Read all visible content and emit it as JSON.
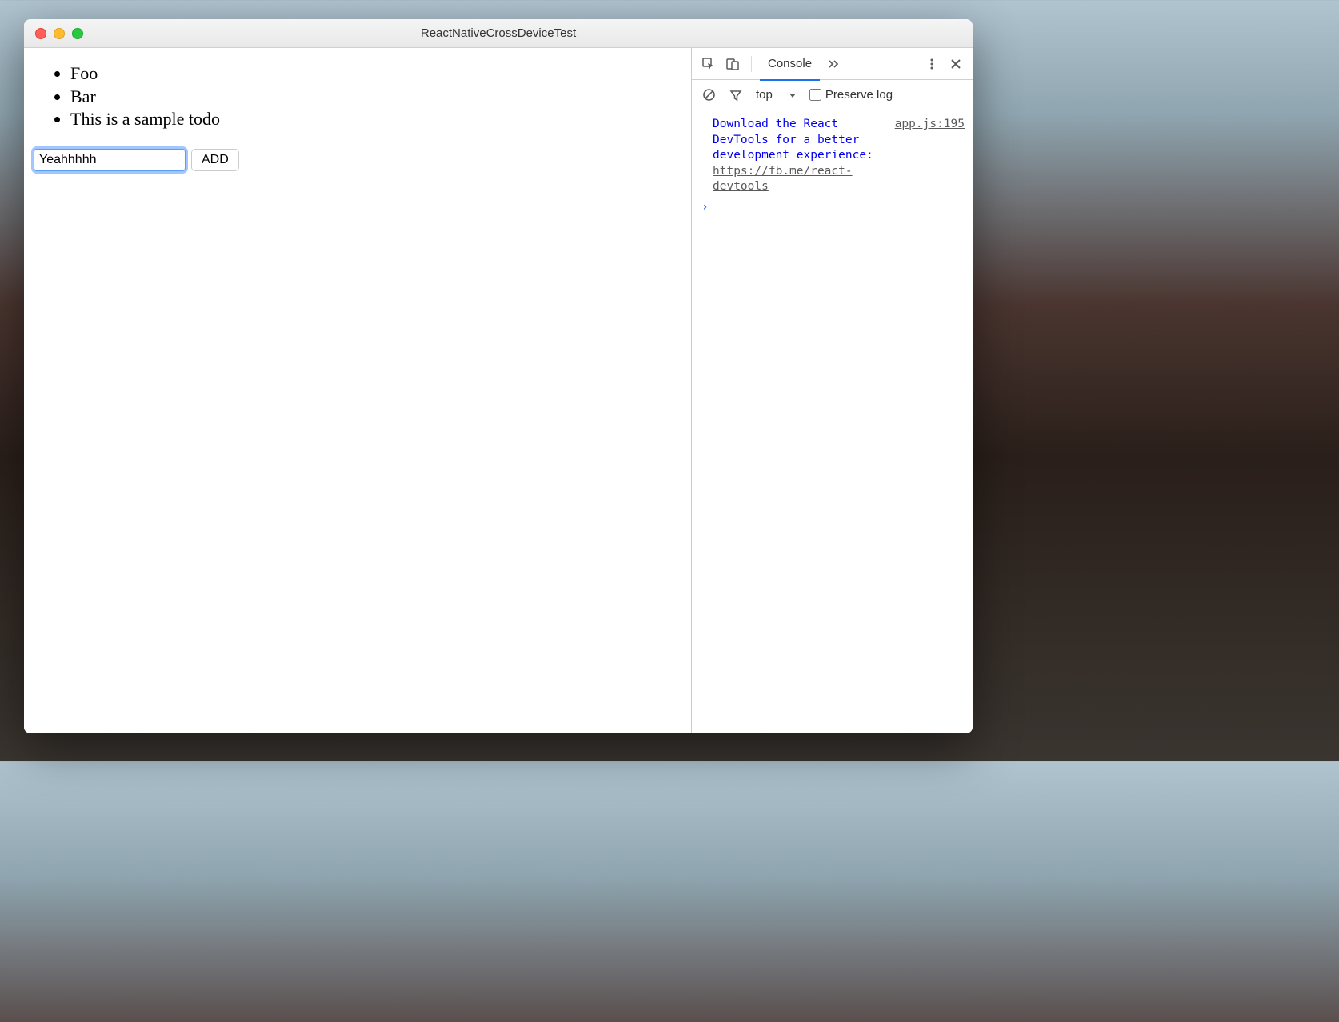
{
  "window": {
    "title": "ReactNativeCrossDeviceTest"
  },
  "app": {
    "todos": [
      "Foo",
      "Bar",
      "This is a sample todo"
    ],
    "input_value": "Yeahhhhh",
    "add_button_label": "ADD"
  },
  "devtools": {
    "tabs": {
      "console": "Console"
    },
    "filter": {
      "context": "top",
      "preserve_log_label": "Preserve log",
      "preserve_log_checked": false
    },
    "console": {
      "message": "Download the React DevTools for a better development experience: ",
      "message_link": "https://fb.me/react-devtools",
      "source": "app.js:195",
      "prompt": "›"
    }
  }
}
